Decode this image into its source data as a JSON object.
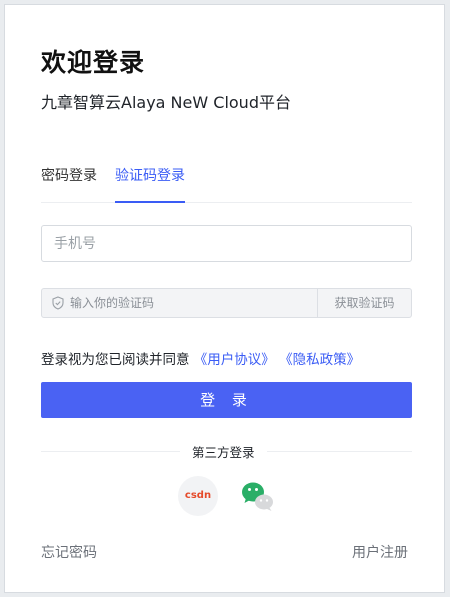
{
  "header": {
    "title": "欢迎登录",
    "subtitle": "九章智算云Alaya NeW Cloud平台"
  },
  "tabs": [
    {
      "label": "密码登录",
      "active": false
    },
    {
      "label": "验证码登录",
      "active": true
    }
  ],
  "form": {
    "phone_placeholder": "手机号",
    "code_placeholder": "输入你的验证码",
    "get_code_label": "获取验证码"
  },
  "agreement": {
    "prefix": "登录视为您已阅读并同意",
    "user_agreement": "《用户协议》",
    "privacy_policy": "《隐私政策》"
  },
  "login_button": "登 录",
  "third_party": {
    "label": "第三方登录",
    "providers": [
      {
        "name": "csdn-icon",
        "text": "csdn"
      },
      {
        "name": "wechat-icon"
      }
    ]
  },
  "footer": {
    "forgot_password": "忘记密码",
    "register": "用户注册"
  },
  "colors": {
    "accent": "#3a5cf5",
    "button": "#4a62f3",
    "wechat": "#2aae67"
  }
}
